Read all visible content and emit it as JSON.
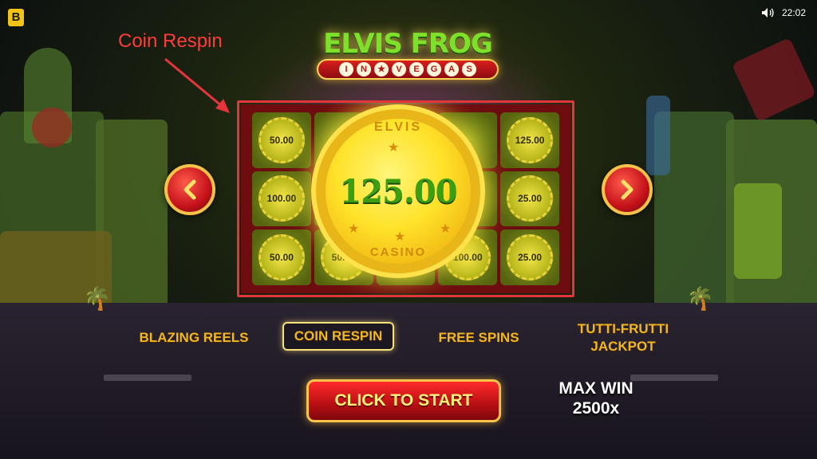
{
  "app": {
    "badge": "B",
    "time": "22:02",
    "sound_icon": "speaker-icon"
  },
  "title": {
    "main": "ELVIS FROG",
    "sub_letters": [
      "I",
      "N",
      "★",
      "V",
      "E",
      "G",
      "A",
      "S"
    ]
  },
  "annotation": {
    "label": "Coin Respin",
    "color": "#ff3b3b"
  },
  "preview": {
    "coin": {
      "top_text": "ELVIS",
      "value": "125.00",
      "bottom_text": "CASINO"
    },
    "grid": [
      [
        "50.00",
        "",
        "",
        "",
        "125.00"
      ],
      [
        "100.00",
        "",
        "",
        "",
        "25.00"
      ],
      [
        "50.00",
        "50.00",
        "",
        "100.00",
        "25.00"
      ]
    ]
  },
  "features": [
    {
      "label": "BLAZING REELS",
      "active": false
    },
    {
      "label": "COIN RESPIN",
      "active": true
    },
    {
      "label": "FREE SPINS",
      "active": false
    },
    {
      "label": "TUTTI-FRUTTI JACKPOT",
      "line1": "TUTTI-FRUTTI",
      "line2": "JACKPOT",
      "active": false
    }
  ],
  "start_button": {
    "label": "CLICK TO START"
  },
  "max_win": {
    "line1": "MAX WIN",
    "line2": "2500x"
  },
  "colors": {
    "accent": "#f2b622",
    "button_red": "#c4121a",
    "annotation": "#e3353a"
  }
}
